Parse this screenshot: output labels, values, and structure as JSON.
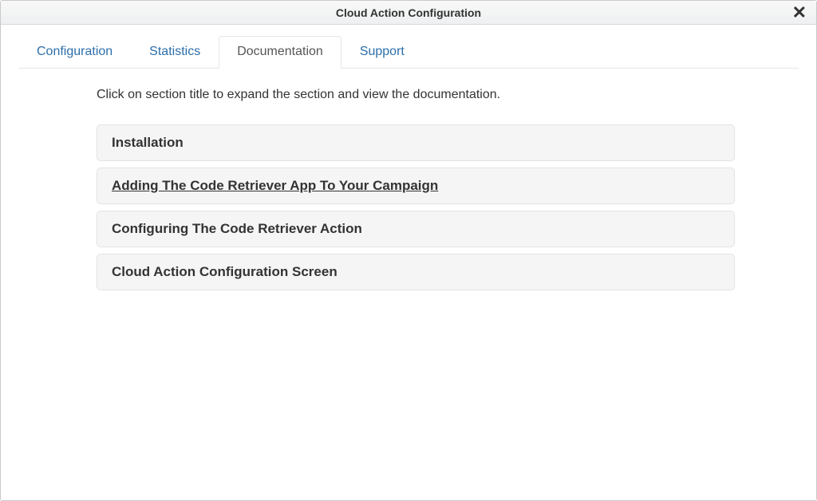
{
  "window": {
    "title": "Cloud Action Configuration"
  },
  "tabs": [
    {
      "label": "Configuration",
      "active": false
    },
    {
      "label": "Statistics",
      "active": false
    },
    {
      "label": "Documentation",
      "active": true
    },
    {
      "label": "Support",
      "active": false
    }
  ],
  "instruction": "Click on section title to expand the section and view the documentation.",
  "sections": [
    {
      "title": "Installation",
      "underline": false
    },
    {
      "title": "Adding The Code Retriever App To Your Campaign",
      "underline": true
    },
    {
      "title": "Configuring The Code Retriever Action",
      "underline": false
    },
    {
      "title": "Cloud Action Configuration Screen",
      "underline": false
    }
  ]
}
